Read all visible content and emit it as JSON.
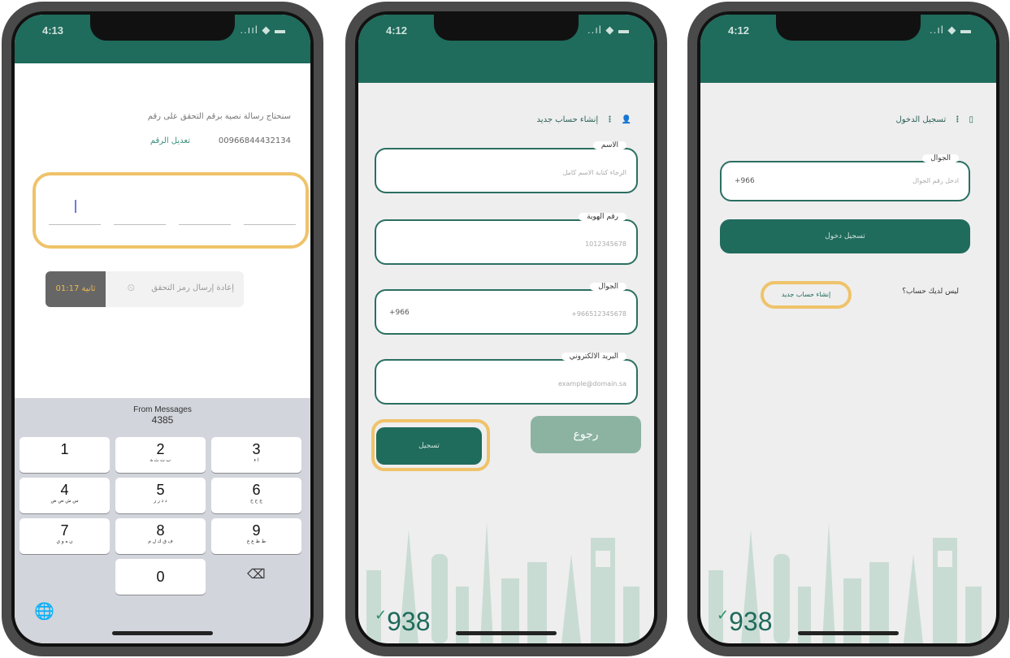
{
  "screens": {
    "otp": {
      "status_time": "4:13",
      "status_icons": "..ııl ◆ ▬",
      "message": "سنحتاج رسالة نصية برقم التحقق على رقم",
      "phone_number": "00966844432134",
      "edit_number": "تعديل الرقم",
      "otp_value": "",
      "resend_label": "إعادة إرسال رمز التحقق",
      "resend_timer": "01:17 ثانية",
      "keyboard": {
        "suggestion_source": "From Messages",
        "suggestion_code": "4385",
        "keys": [
          {
            "digit": "1",
            "letters": ""
          },
          {
            "digit": "2",
            "letters": "ب ت ث ة"
          },
          {
            "digit": "3",
            "letters": "ا ء"
          },
          {
            "digit": "4",
            "letters": "س ش ص ض"
          },
          {
            "digit": "5",
            "letters": "د ذ ر ز"
          },
          {
            "digit": "6",
            "letters": "ج ح خ"
          },
          {
            "digit": "7",
            "letters": "ن ه و ي"
          },
          {
            "digit": "8",
            "letters": "ف ق ك ل م"
          },
          {
            "digit": "9",
            "letters": "ط ظ ع غ"
          },
          {
            "digit": "0",
            "letters": ""
          }
        ]
      }
    },
    "register": {
      "status_time": "4:12",
      "status_icons": "..ıl ◆ ▬",
      "title": "إنشاء حساب جديد",
      "fields": [
        {
          "label": "الاسم",
          "hint": "الرجاء كتابة الاسم كامل",
          "prefix": ""
        },
        {
          "label": "رقم الهوية",
          "hint": "1012345678",
          "prefix": ""
        },
        {
          "label": "الجوال",
          "hint": "+966512345678",
          "prefix": "+966"
        },
        {
          "label": "البريد الالكتروني",
          "hint": "example@domain.sa",
          "prefix": ""
        }
      ],
      "register_button": "تسجيل",
      "back_button": "رجوع",
      "brand": "938"
    },
    "login": {
      "status_time": "4:12",
      "status_icons": "..ıl ◆ ▬",
      "title": "تسجيل الدخول",
      "mobile_label": "الجوال",
      "mobile_hint": "ادخل رقم الجوال",
      "mobile_prefix": "+966",
      "login_button": "تسجيل دخول",
      "no_account": "ليس لديك حساب؟",
      "create_account": "إنشاء حساب جديد",
      "brand": "938"
    }
  },
  "colors": {
    "primary": "#1f6b5c",
    "secondary": "#8cb3a2",
    "highlight": "#efc36a",
    "background": "#eeeeee"
  }
}
